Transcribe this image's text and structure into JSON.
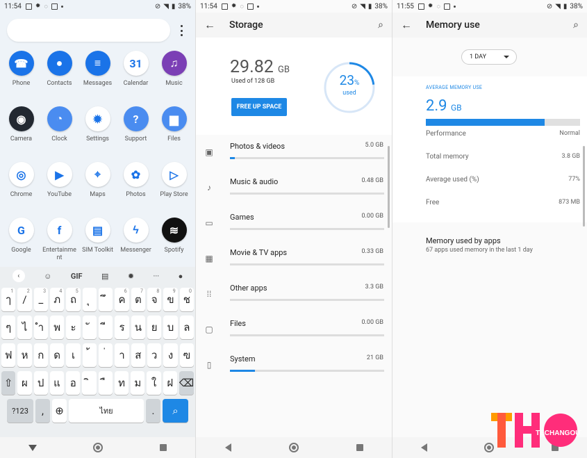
{
  "screen1": {
    "status": {
      "time": "11:54",
      "battery": "38%"
    },
    "apps": [
      {
        "label": "Phone",
        "color": "#1a73e8",
        "glyph": "☎"
      },
      {
        "label": "Contacts",
        "color": "#1a73e8",
        "glyph": "●"
      },
      {
        "label": "Messages",
        "color": "#1a73e8",
        "glyph": "≡"
      },
      {
        "label": "Calendar",
        "color": "#ffffff",
        "glyph": "31"
      },
      {
        "label": "Music",
        "color": "#7b3fb5",
        "glyph": "♫"
      },
      {
        "label": "Camera",
        "color": "#222831",
        "glyph": "◉"
      },
      {
        "label": "Clock",
        "color": "#4a8cf0",
        "glyph": "◔"
      },
      {
        "label": "Settings",
        "color": "#ffffff",
        "glyph": "✹"
      },
      {
        "label": "Support",
        "color": "#4a8cf0",
        "glyph": "?"
      },
      {
        "label": "Files",
        "color": "#4a8cf0",
        "glyph": "▆"
      },
      {
        "label": "Chrome",
        "color": "#ffffff",
        "glyph": "◎"
      },
      {
        "label": "YouTube",
        "color": "#ffffff",
        "glyph": "▶"
      },
      {
        "label": "Maps",
        "color": "#ffffff",
        "glyph": "⌖"
      },
      {
        "label": "Photos",
        "color": "#ffffff",
        "glyph": "✿"
      },
      {
        "label": "Play Store",
        "color": "#ffffff",
        "glyph": "▷"
      },
      {
        "label": "Google",
        "color": "#ffffff",
        "glyph": "G"
      },
      {
        "label": "Entertainme\nnt",
        "color": "#ffffff",
        "glyph": "f"
      },
      {
        "label": "SIM Toolkit",
        "color": "#ffffff",
        "glyph": "▤"
      },
      {
        "label": "Messenger",
        "color": "#ffffff",
        "glyph": "ϟ"
      },
      {
        "label": "Spotify",
        "color": "#111111",
        "glyph": "≋"
      }
    ],
    "keyboard_top": {
      "gif": "GIF"
    },
    "keyboard_rows": [
      [
        [
          "ๅ",
          "1"
        ],
        [
          "/",
          "2"
        ],
        [
          "_",
          "3"
        ],
        [
          "ภ",
          "4"
        ],
        [
          "ถ",
          "5"
        ],
        [
          "ุ",
          ""
        ],
        [
          "ึ",
          ""
        ],
        [
          "ค",
          "6"
        ],
        [
          "ต",
          "7"
        ],
        [
          "จ",
          "8"
        ],
        [
          "ข",
          "9"
        ],
        [
          "ช",
          "0"
        ]
      ],
      [
        [
          "ๆ",
          ""
        ],
        [
          "ไ",
          ""
        ],
        [
          "ำ",
          ""
        ],
        [
          "พ",
          ""
        ],
        [
          "ะ",
          ""
        ],
        [
          "ั",
          ""
        ],
        [
          "ี",
          ""
        ],
        [
          "ร",
          ""
        ],
        [
          "น",
          ""
        ],
        [
          "ย",
          ""
        ],
        [
          "บ",
          ""
        ],
        [
          "ล",
          ""
        ]
      ],
      [
        [
          "ฟ",
          ""
        ],
        [
          "ห",
          ""
        ],
        [
          "ก",
          ""
        ],
        [
          "ด",
          ""
        ],
        [
          "เ",
          ""
        ],
        [
          "้",
          ""
        ],
        [
          "่",
          ""
        ],
        [
          "า",
          ""
        ],
        [
          "ส",
          ""
        ],
        [
          "ว",
          ""
        ],
        [
          "ง",
          ""
        ],
        [
          "ฃ",
          ""
        ]
      ],
      [
        [
          "ผ",
          ""
        ],
        [
          "ป",
          ""
        ],
        [
          "แ",
          ""
        ],
        [
          "อ",
          ""
        ],
        [
          "ิ",
          ""
        ],
        [
          "ื",
          ""
        ],
        [
          "ท",
          ""
        ],
        [
          "ม",
          ""
        ],
        [
          "ใ",
          ""
        ],
        [
          "ฝ",
          ""
        ]
      ]
    ],
    "kb_bottom": {
      "sym": "?123",
      "space": "ไทย",
      "period": "."
    }
  },
  "screen2": {
    "status": {
      "time": "11:54",
      "battery": "38%"
    },
    "title": "Storage",
    "used_value": "29.82",
    "used_unit": "GB",
    "used_of": "Used of 128 GB",
    "free_up": "FREE UP SPACE",
    "percent": "23",
    "percent_sign": "%",
    "percent_label": "used",
    "percent_value": 0.23,
    "items": [
      {
        "name": "Photos & videos",
        "size": "5.0 GB",
        "fill": 0.03,
        "icon": "▣"
      },
      {
        "name": "Music & audio",
        "size": "0.48 GB",
        "fill": 0.0,
        "icon": "♪"
      },
      {
        "name": "Games",
        "size": "0.00 GB",
        "fill": 0.0,
        "icon": "▭"
      },
      {
        "name": "Movie & TV apps",
        "size": "0.33 GB",
        "fill": 0.0,
        "icon": "▦"
      },
      {
        "name": "Other apps",
        "size": "3.3 GB",
        "fill": 0.0,
        "icon": "⁞⁞"
      },
      {
        "name": "Files",
        "size": "0.00 GB",
        "fill": 0.0,
        "icon": "▢"
      },
      {
        "name": "System",
        "size": "21 GB",
        "fill": 0.16,
        "icon": "▯"
      }
    ]
  },
  "screen3": {
    "status": {
      "time": "11:55",
      "battery": "38%"
    },
    "title": "Memory use",
    "period": "1 DAY",
    "avg_label": "AVERAGE MEMORY USE",
    "avg_value": "2.9",
    "avg_unit": "GB",
    "mem_fill": 0.77,
    "rows": [
      {
        "label": "Performance",
        "value": "Normal"
      },
      {
        "label": "Total memory",
        "value": "3.8 GB"
      },
      {
        "label": "Average used (%)",
        "value": "77%"
      },
      {
        "label": "Free",
        "value": "873 MB"
      }
    ],
    "apps_title": "Memory used by apps",
    "apps_sub": "67 apps used memory in the last 1 day"
  },
  "logo": {
    "text": "TECHANGOUT",
    "brand_colors": [
      "#ff2d7a",
      "#ff9a00",
      "#ff4fa0"
    ]
  }
}
